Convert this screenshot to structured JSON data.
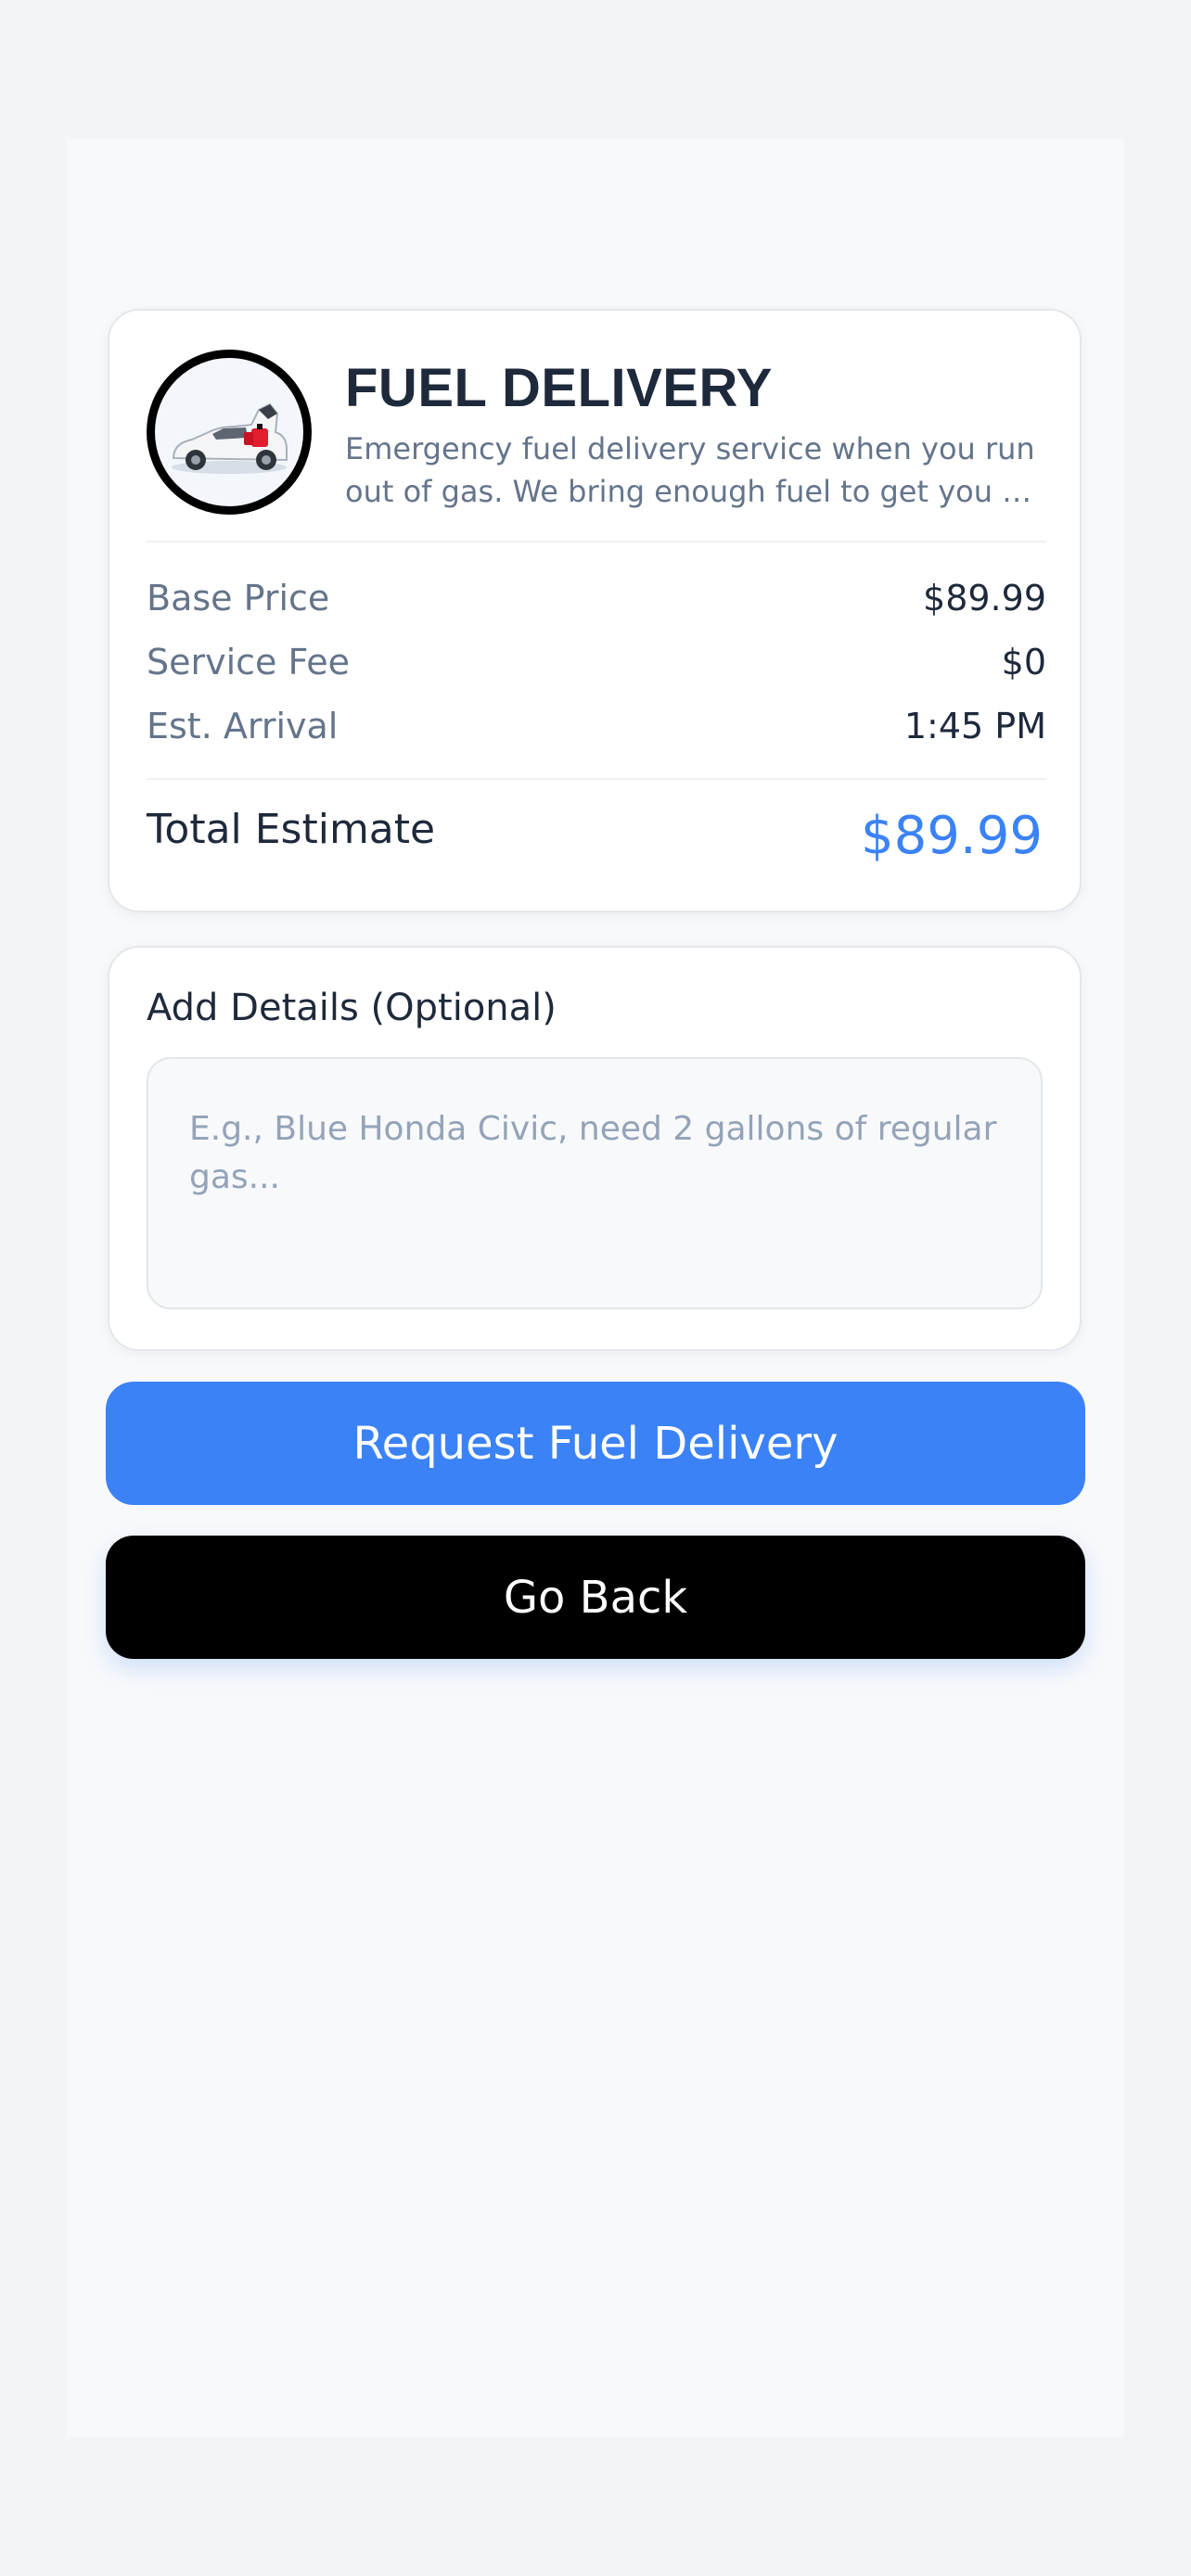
{
  "service": {
    "title": "FUEL DELIVERY",
    "description": "Emergency fuel delivery service when you run out of gas. We bring enough fuel to get you to the nearest gas station.",
    "image_icon": "car-with-fuel-can-icon"
  },
  "pricing": {
    "rows": [
      {
        "label": "Base Price",
        "value": "$89.99"
      },
      {
        "label": "Service Fee",
        "value": "$0"
      },
      {
        "label": "Est. Arrival",
        "value": "1:45 PM"
      }
    ],
    "total_label": "Total Estimate",
    "total_value": "$89.99"
  },
  "details": {
    "label": "Add Details (Optional)",
    "placeholder": "E.g., Blue Honda Civic, need 2 gallons of regular gas...",
    "value": ""
  },
  "actions": {
    "request_label": "Request Fuel Delivery",
    "back_label": "Go Back"
  },
  "colors": {
    "accent": "#3b82f6",
    "back_button": "#000000",
    "text_primary": "#1e293b",
    "text_secondary": "#64748b"
  }
}
